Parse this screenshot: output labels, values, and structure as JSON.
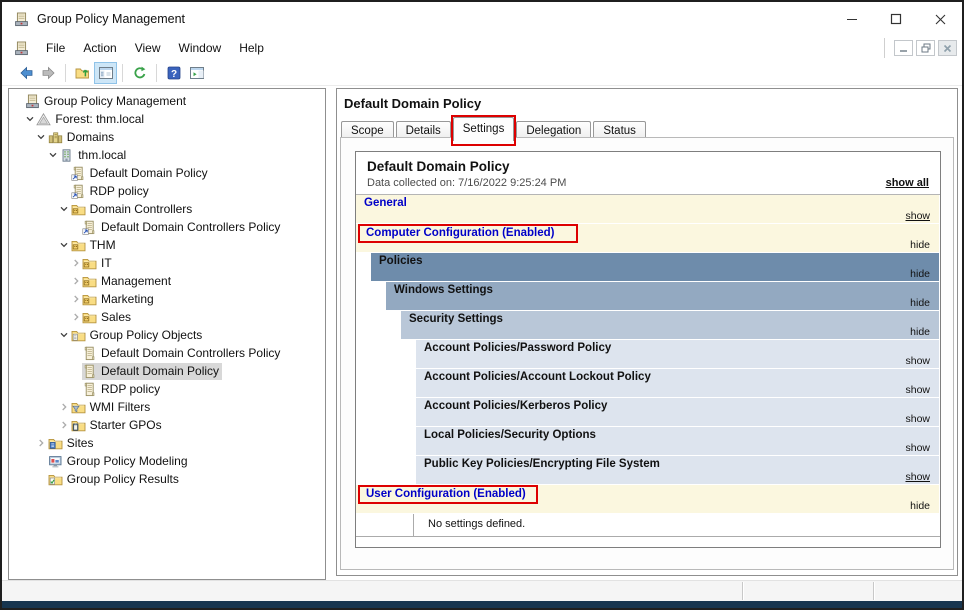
{
  "window": {
    "title": "Group Policy Management"
  },
  "menu": {
    "items": [
      "File",
      "Action",
      "View",
      "Window",
      "Help"
    ]
  },
  "toolbar": {
    "buttons": [
      "back",
      "forward",
      "sep",
      "up-one-level",
      "show-console-tree",
      "sep",
      "refresh",
      "sep",
      "help",
      "show-action-pane"
    ],
    "active_button": "show-console-tree"
  },
  "tree": {
    "items": [
      {
        "label": "Group Policy Management",
        "level": 0,
        "icon": "gpmc-console",
        "expand": "none"
      },
      {
        "label": "Forest: thm.local",
        "level": 1,
        "icon": "forest",
        "expand": "open"
      },
      {
        "label": "Domains",
        "level": 2,
        "icon": "domains",
        "expand": "open"
      },
      {
        "label": "thm.local",
        "level": 3,
        "icon": "domain",
        "expand": "open"
      },
      {
        "label": "Default Domain Policy",
        "level": 4,
        "icon": "gpo-link",
        "expand": "none"
      },
      {
        "label": "RDP policy",
        "level": 4,
        "icon": "gpo-link",
        "expand": "none"
      },
      {
        "label": "Domain Controllers",
        "level": 4,
        "icon": "ou-folder",
        "expand": "open"
      },
      {
        "label": "Default Domain Controllers Policy",
        "level": 5,
        "icon": "gpo-link",
        "expand": "none"
      },
      {
        "label": "THM",
        "level": 4,
        "icon": "ou-folder",
        "expand": "open"
      },
      {
        "label": "IT",
        "level": 5,
        "icon": "ou-folder",
        "expand": "closed"
      },
      {
        "label": "Management",
        "level": 5,
        "icon": "ou-folder",
        "expand": "closed"
      },
      {
        "label": "Marketing",
        "level": 5,
        "icon": "ou-folder",
        "expand": "closed"
      },
      {
        "label": "Sales",
        "level": 5,
        "icon": "ou-folder",
        "expand": "closed"
      },
      {
        "label": "Group Policy Objects",
        "level": 4,
        "icon": "gpo-objects-folder",
        "expand": "open"
      },
      {
        "label": "Default Domain Controllers Policy",
        "level": 5,
        "icon": "gpo",
        "expand": "none"
      },
      {
        "label": "Default Domain Policy",
        "level": 5,
        "icon": "gpo",
        "expand": "none",
        "selected": true
      },
      {
        "label": "RDP policy",
        "level": 5,
        "icon": "gpo",
        "expand": "none"
      },
      {
        "label": "WMI Filters",
        "level": 4,
        "icon": "wmi-folder",
        "expand": "closed"
      },
      {
        "label": "Starter GPOs",
        "level": 4,
        "icon": "starter-gpo-folder",
        "expand": "closed"
      },
      {
        "label": "Sites",
        "level": 2,
        "icon": "sites-folder",
        "expand": "closed"
      },
      {
        "label": "Group Policy Modeling",
        "level": 2,
        "icon": "gp-modeling",
        "expand": "none"
      },
      {
        "label": "Group Policy Results",
        "level": 2,
        "icon": "gp-results-folder",
        "expand": "none"
      }
    ]
  },
  "main": {
    "pane_title": "Default Domain Policy",
    "tabs": [
      {
        "label": "Scope"
      },
      {
        "label": "Details"
      },
      {
        "label": "Settings",
        "active": true,
        "annotated": true
      },
      {
        "label": "Delegation"
      },
      {
        "label": "Status"
      }
    ],
    "report": {
      "title": "Default Domain Policy",
      "collected_on": "Data collected on: 7/16/2022 9:25:24 PM",
      "show_all_label": "show all",
      "sections": [
        {
          "label": "General",
          "level": 0,
          "style": "yellow",
          "label_color": "blue",
          "link": "show",
          "link_underline": true
        },
        {
          "label": "Computer Configuration (Enabled)",
          "level": 0,
          "style": "yellow",
          "label_color": "blue",
          "link": "hide",
          "annotated": true
        },
        {
          "label": "Policies",
          "level": 1,
          "style": "band1",
          "link": "hide"
        },
        {
          "label": "Windows Settings",
          "level": 2,
          "style": "band2",
          "link": "hide"
        },
        {
          "label": "Security Settings",
          "level": 3,
          "style": "band3",
          "link": "hide"
        },
        {
          "label": "Account Policies/Password Policy",
          "level": 4,
          "style": "leaf",
          "link": "show"
        },
        {
          "label": "Account Policies/Account Lockout Policy",
          "level": 4,
          "style": "leaf",
          "link": "show"
        },
        {
          "label": "Account Policies/Kerberos Policy",
          "level": 4,
          "style": "leaf",
          "link": "show"
        },
        {
          "label": "Local Policies/Security Options",
          "level": 4,
          "style": "leaf",
          "link": "show"
        },
        {
          "label": "Public Key Policies/Encrypting File System",
          "level": 4,
          "style": "leaf",
          "link": "show",
          "link_underline": true
        },
        {
          "label": "User Configuration (Enabled)",
          "level": 0,
          "style": "yellow",
          "label_color": "blue",
          "link": "hide",
          "annotated": true,
          "annotation_narrow": true
        }
      ],
      "empty_message": "No settings defined."
    }
  },
  "colors": {
    "annotation_red": "#dd0000",
    "band_yellow": "#fbf7df",
    "band_level1": "#6e8cab",
    "band_level2": "#93a9c1",
    "band_level3": "#b9c7d8",
    "band_leaf": "#dde4ee",
    "link_blue": "#0000c8",
    "bottom_edge": "#17354f"
  }
}
